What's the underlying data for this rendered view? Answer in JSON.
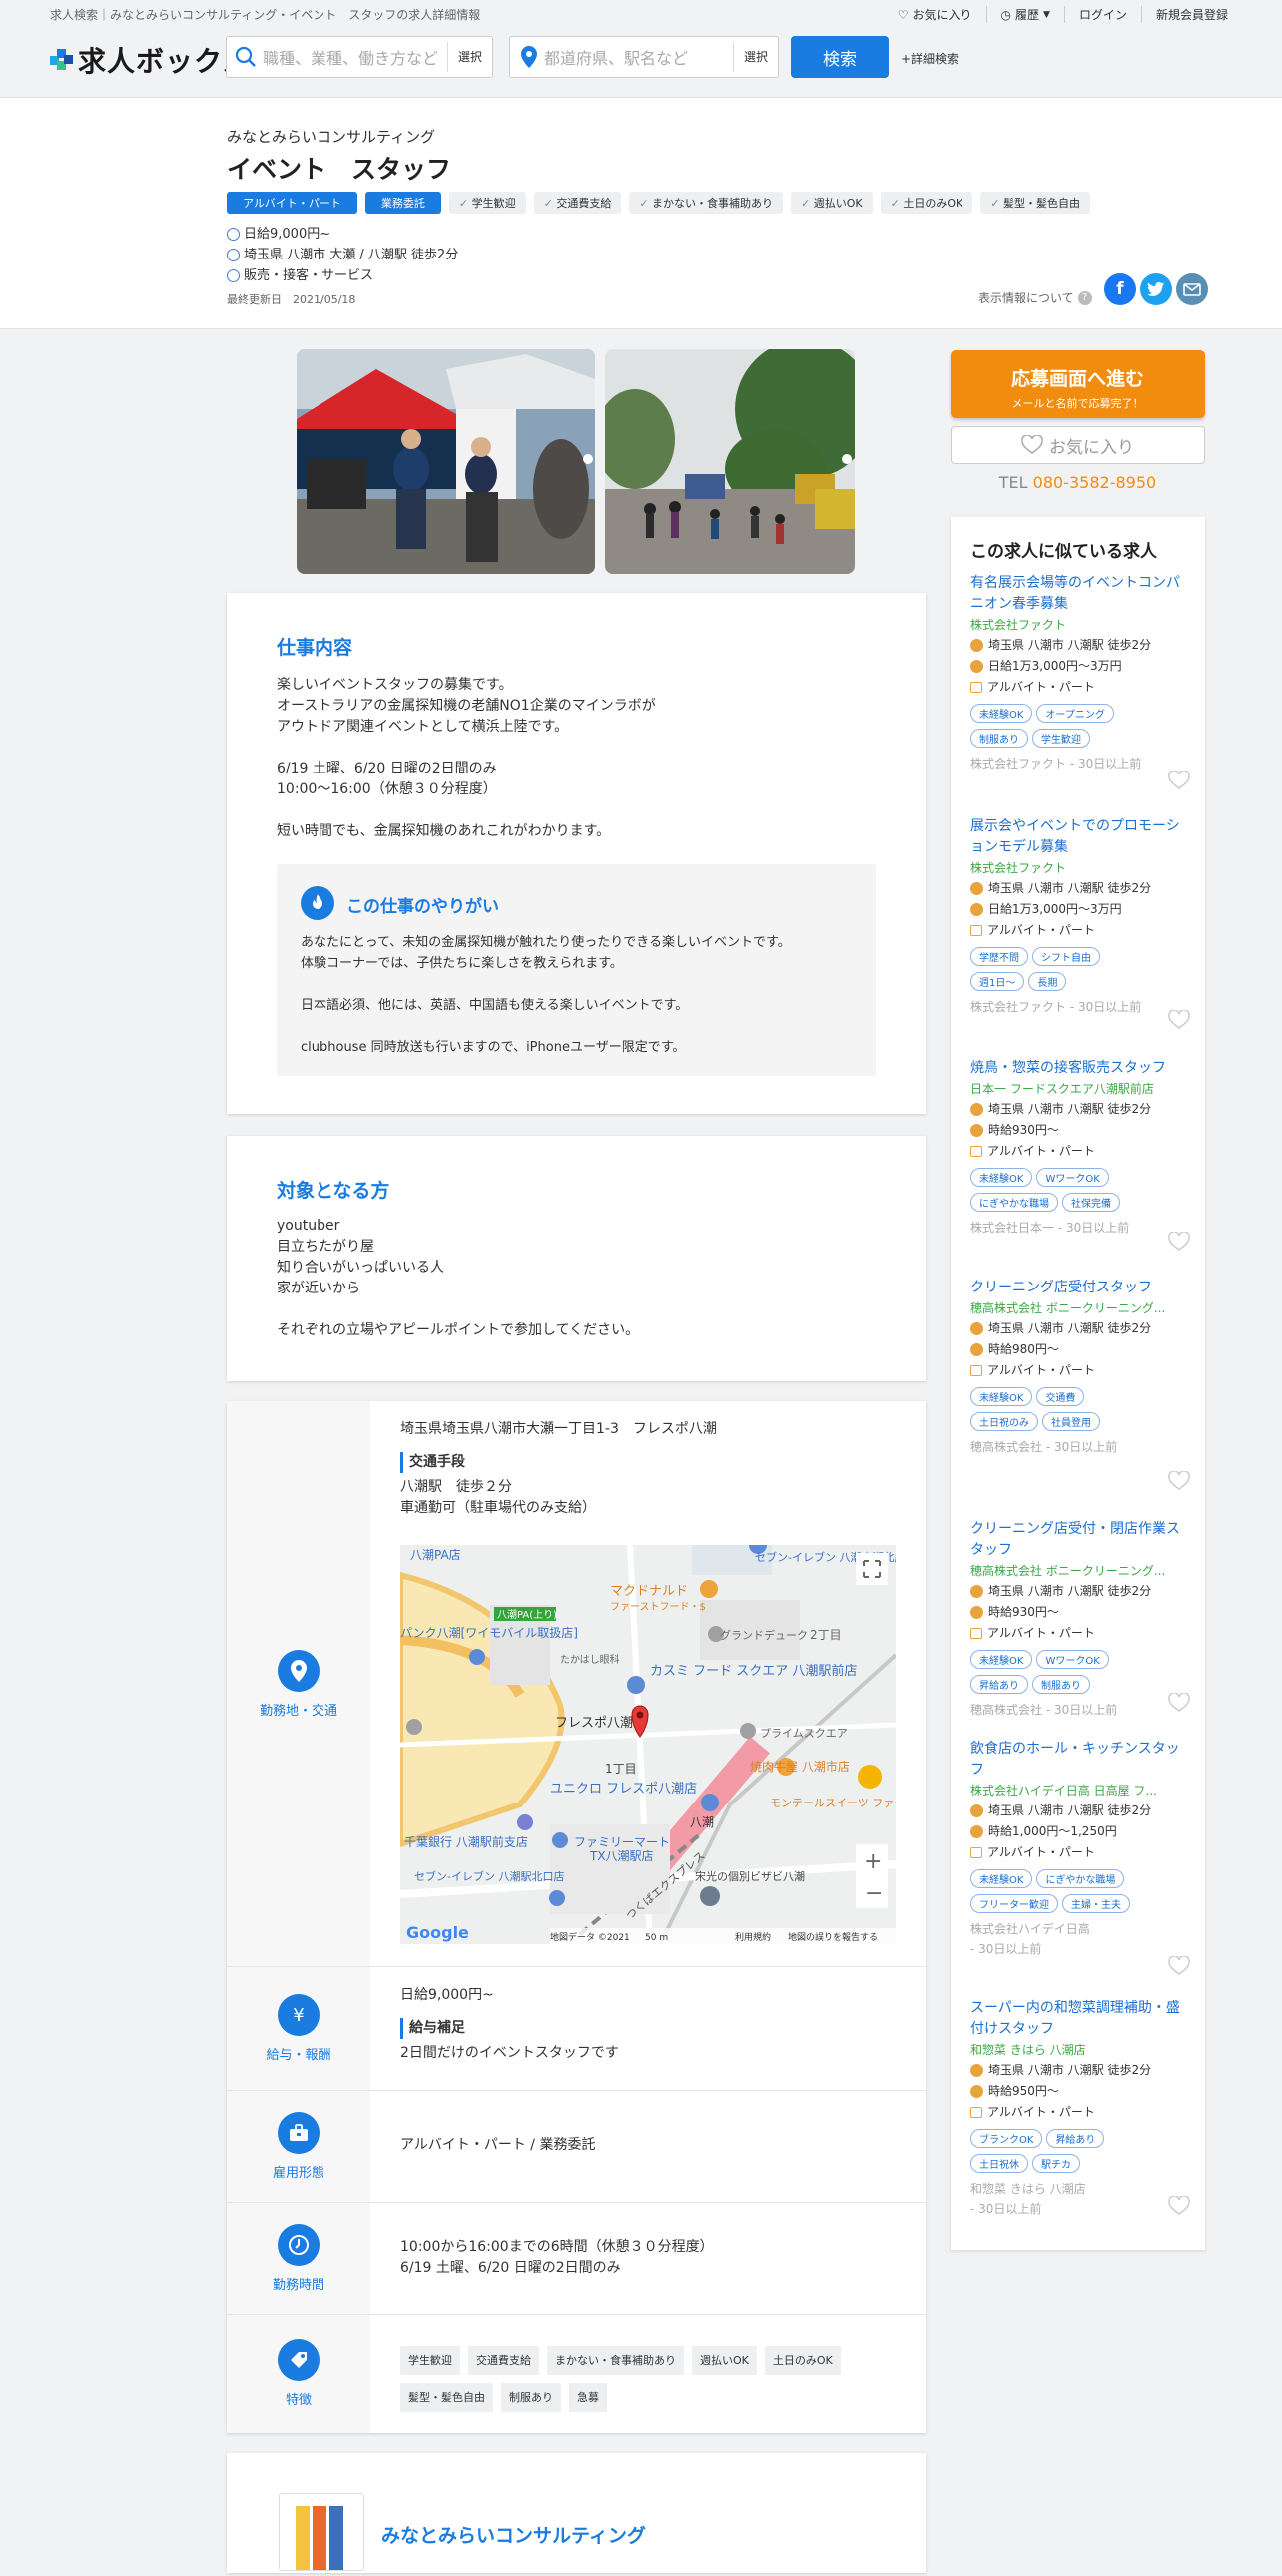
{
  "header": {
    "breadcrumb": "求人検索｜みなとみらいコンサルティング・イベント　スタッフの求人詳細情報",
    "links": [
      "お気に入り",
      "履歴",
      "ログイン",
      "新規会員登録"
    ],
    "logo": "求人ボックス",
    "keyword_placeholder": "職種、業種、働き方など",
    "keyword_select": "選択",
    "location_placeholder": "都道府県、駅名など",
    "location_select": "選択",
    "search_label": "検索",
    "advanced_label": "+詳細検索"
  },
  "job": {
    "company": "みなとみらいコンサルティング",
    "title": "イベント　スタッフ",
    "type_tags": [
      "アルバイト・パート",
      "業務委託"
    ],
    "feature_tags": [
      "学生歓迎",
      "交通費支給",
      "まかない・食事補助あり",
      "週払いOK",
      "土日のみOK",
      "髪型・髪色自由"
    ],
    "salary": "日給9,000円~",
    "location": "埼玉県 八潮市 大瀬 / 八潮駅 徒歩2分",
    "category": "販売・接客・サービス",
    "updated": "最終更新日　2021/05/18",
    "display_info": "表示情報について"
  },
  "sidebar": {
    "apply_main": "応募画面へ進む",
    "apply_sub": "メールと名前で応募完了！",
    "favorite": "お気に入り",
    "tel_label": "TEL",
    "tel_number": "080-3582-8950",
    "similar_title": "この求人に似ている求人",
    "similar": [
      {
        "title": "有名展示会場等のイベントコンパニオン春季募集",
        "company": "株式会社ファクト",
        "location": "埼玉県 八潮市 八潮駅 徒歩2分",
        "salary": "日給1万3,000円～3万円",
        "type": "アルバイト・パート",
        "tags": [
          "未経験OK",
          "オープニング",
          "制服あり",
          "学生歓迎"
        ],
        "footer": "株式会社ファクト - 30日以上前"
      },
      {
        "title": "展示会やイベントでのプロモーションモデル募集",
        "company": "株式会社ファクト",
        "location": "埼玉県 八潮市 八潮駅 徒歩2分",
        "salary": "日給1万3,000円～3万円",
        "type": "アルバイト・パート",
        "tags": [
          "学歴不問",
          "シフト自由",
          "週1日～",
          "長期"
        ],
        "footer": "株式会社ファクト - 30日以上前"
      },
      {
        "title": "焼鳥・惣菜の接客販売スタッフ",
        "company": "日本一 フードスクエア八潮駅前店",
        "location": "埼玉県 八潮市 八潮駅 徒歩2分",
        "salary": "時給930円～",
        "type": "アルバイト・パート",
        "tags": [
          "未経験OK",
          "WワークOK",
          "にぎやかな職場",
          "社保完備"
        ],
        "footer": "株式会社日本一 - 30日以上前"
      },
      {
        "title": "クリーニング店受付スタッフ",
        "company": "穂高株式会社 ボニークリーニング...",
        "location": "埼玉県 八潮市 八潮駅 徒歩2分",
        "salary": "時給980円～",
        "type": "アルバイト・パート",
        "tags": [
          "未経験OK",
          "交通費",
          "土日祝のみ",
          "社員登用"
        ],
        "footer": "穂高株式会社 - 30日以上前"
      },
      {
        "title": "クリーニング店受付・閉店作業スタッフ",
        "company": "穂高株式会社 ボニークリーニング...",
        "location": "埼玉県 八潮市 八潮駅 徒歩2分",
        "salary": "時給930円～",
        "type": "アルバイト・パート",
        "tags": [
          "未経験OK",
          "WワークOK",
          "昇給あり",
          "制服あり"
        ],
        "footer": "穂高株式会社 - 30日以上前"
      },
      {
        "title": "飲食店のホール・キッチンスタッフ",
        "company": "株式会社ハイデイ日高 日高屋 フ...",
        "location": "埼玉県 八潮市 八潮駅 徒歩2分",
        "salary": "時給1,000円～1,250円",
        "type": "アルバイト・パート",
        "tags": [
          "未経験OK",
          "にぎやかな職場",
          "フリーター歓迎",
          "主婦・主夫"
        ],
        "footer": "株式会社ハイデイ日高\n - 30日以上前"
      },
      {
        "title": "スーパー内の和惣菜調理補助・盛付けスタッフ",
        "company": "和惣菜 きはら 八潮店",
        "location": "埼玉県 八潮市 八潮駅 徒歩2分",
        "salary": "時給950円～",
        "type": "アルバイト・パート",
        "tags": [
          "ブランクOK",
          "昇給あり",
          "土日祝休",
          "駅チカ"
        ],
        "footer": "和惣菜 きはら 八潮店\n - 30日以上前"
      }
    ]
  },
  "description": {
    "title": "仕事内容",
    "body": "楽しいイベントスタッフの募集です。\nオーストラリアの金属探知機の老舗NO1企業のマインラボが\nアウトドア関連イベントとして横浜上陸です。\n\n6/19 土曜、6/20 日曜の2日間のみ\n10:00～16:00（休憩３０分程度）\n\n短い時間でも、金属探知機のあれこれがわかります。",
    "highlight_title": "この仕事のやりがい",
    "highlight_body": "あなたにとって、未知の金属探知機が触れたり使ったりできる楽しいイベントです。\n体験コーナーでは、子供たちに楽しさを教えられます。\n\n日本語必須、他には、英語、中国語も使える楽しいイベントです。\n\nclubhouse 同時放送も行いますので、iPhoneユーザー限定です。"
  },
  "target": {
    "title": "対象となる方",
    "body": "youtuber\n目立ちたがり屋\n知り合いがいっぱいいる人\n家が近いから\n\nそれぞれの立場やアピールポイントで参加してください。"
  },
  "details": {
    "location_label": "勤務地・交通",
    "address": "埼玉県埼玉県八潮市大瀬一丁目1-3　フレスポ八潮",
    "transport_head": "交通手段",
    "transport": "八潮駅　徒歩２分\n車通勤可（駐車場代のみ支給）",
    "map": {
      "places": [
        "八潮PA店",
        "セブン-イレブン 八潮大瀬北店",
        "マクドナルド",
        "ファーストフード・$",
        "八潮PA(上り)",
        "グランドデューク",
        "2丁目",
        "パンク八潮[ワイモバイル取扱店]",
        "たかはし眼科",
        "カスミ フード スクエア 八潮駅前店",
        "フレスポ八潮",
        "プライムスクエア",
        "1丁目",
        "焼肉牛屋 八潮市店",
        "ユニクロ フレスポ八潮店",
        "モンテールスイーツ ファクトリーショップ",
        "千葉銀行 八潮駅前支店",
        "ファミリーマート",
        "TX八潮駅店",
        "八潮",
        "セブン-イレブン 八潮駅北口店",
        "宋光の個別ビザビ八潮",
        "つくばエクスプレス"
      ],
      "footer": [
        "地図データ ©2021",
        "50 m",
        "利用規約",
        "地図の誤りを報告する"
      ],
      "logo": "Google"
    },
    "salary_label": "給与・報酬",
    "salary": "日給9,000円~",
    "salary_head": "給与補足",
    "salary_note": "2日間だけのイベントスタッフです",
    "employment_label": "雇用形態",
    "employment": "アルバイト・パート / 業務委託",
    "hours_label": "勤務時間",
    "hours": "10:00から16:00までの6時間（休憩３０分程度）\n6/19 土曜、6/20 日曜の2日間のみ",
    "features_label": "特徴",
    "features": [
      "学生歓迎",
      "交通費支給",
      "まかない・食事補助あり",
      "週払いOK",
      "土日のみOK",
      "髪型・髪色自由",
      "制服あり",
      "急募"
    ]
  },
  "company_card": {
    "name": "みなとみらいコンサルティング"
  },
  "colors": {
    "primary": "#1a7be0",
    "apply": "#f28c0f",
    "similar_company": "#3aa845"
  }
}
